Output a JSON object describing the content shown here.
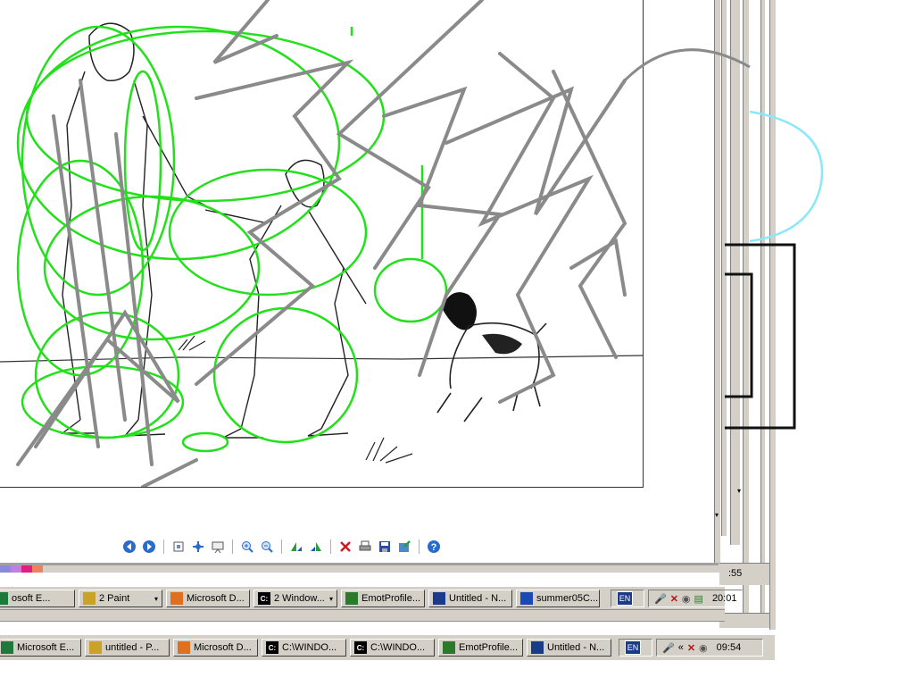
{
  "viewer": {
    "toolbar_icons": [
      "previous-icon",
      "next-icon",
      "best-fit-icon",
      "actual-size-icon",
      "slideshow-icon",
      "zoom-in-icon",
      "zoom-out-icon",
      "rotate-clockwise-icon",
      "rotate-counterclockwise-icon",
      "delete-icon",
      "print-icon",
      "save-icon",
      "edit-icon",
      "help-icon"
    ]
  },
  "status": {
    "partial_time": ":55"
  },
  "taskbar1": {
    "tasks": [
      {
        "label": "osoft E...",
        "icon": "excel-icon",
        "color": "#1f7a3a"
      },
      {
        "label": "2 Paint",
        "icon": "paint-icon",
        "color": "#c9a227",
        "group": true
      },
      {
        "label": "Microsoft D...",
        "icon": "office-icon",
        "color": "#e07020"
      },
      {
        "label": "2 Window...",
        "icon": "console-icon",
        "color": "#000000",
        "group": true
      },
      {
        "label": "EmotProfile...",
        "icon": "app-icon",
        "color": "#2a7a2a"
      },
      {
        "label": "Untitled - N...",
        "icon": "notepad-icon",
        "color": "#1a3a8a"
      },
      {
        "label": "summer05C...",
        "icon": "word-icon",
        "color": "#1a4ab0"
      }
    ],
    "lang": "EN",
    "clock": "20:01"
  },
  "taskbar2": {
    "tasks": [
      {
        "label": "Microsoft E...",
        "icon": "excel-icon",
        "color": "#1f7a3a"
      },
      {
        "label": "untitled - P...",
        "icon": "paint-icon",
        "color": "#c9a227"
      },
      {
        "label": "Microsoft D...",
        "icon": "office-icon",
        "color": "#e07020"
      },
      {
        "label": "C:\\WINDO...",
        "icon": "console-icon",
        "color": "#000000"
      },
      {
        "label": "C:\\WINDO...",
        "icon": "console-icon",
        "color": "#000000"
      },
      {
        "label": "EmotProfile...",
        "icon": "app-icon",
        "color": "#2a7a2a"
      },
      {
        "label": "Untitled - N...",
        "icon": "notepad-icon",
        "color": "#1a3a8a"
      }
    ],
    "lang": "EN",
    "chevron": "«",
    "clock": "09:54"
  },
  "colors": {
    "scribble_green": "#22e01a",
    "scribble_gray": "#8a8a8a",
    "scribble_cyan": "#8ae8f8",
    "window_face": "#d4d0c8"
  }
}
